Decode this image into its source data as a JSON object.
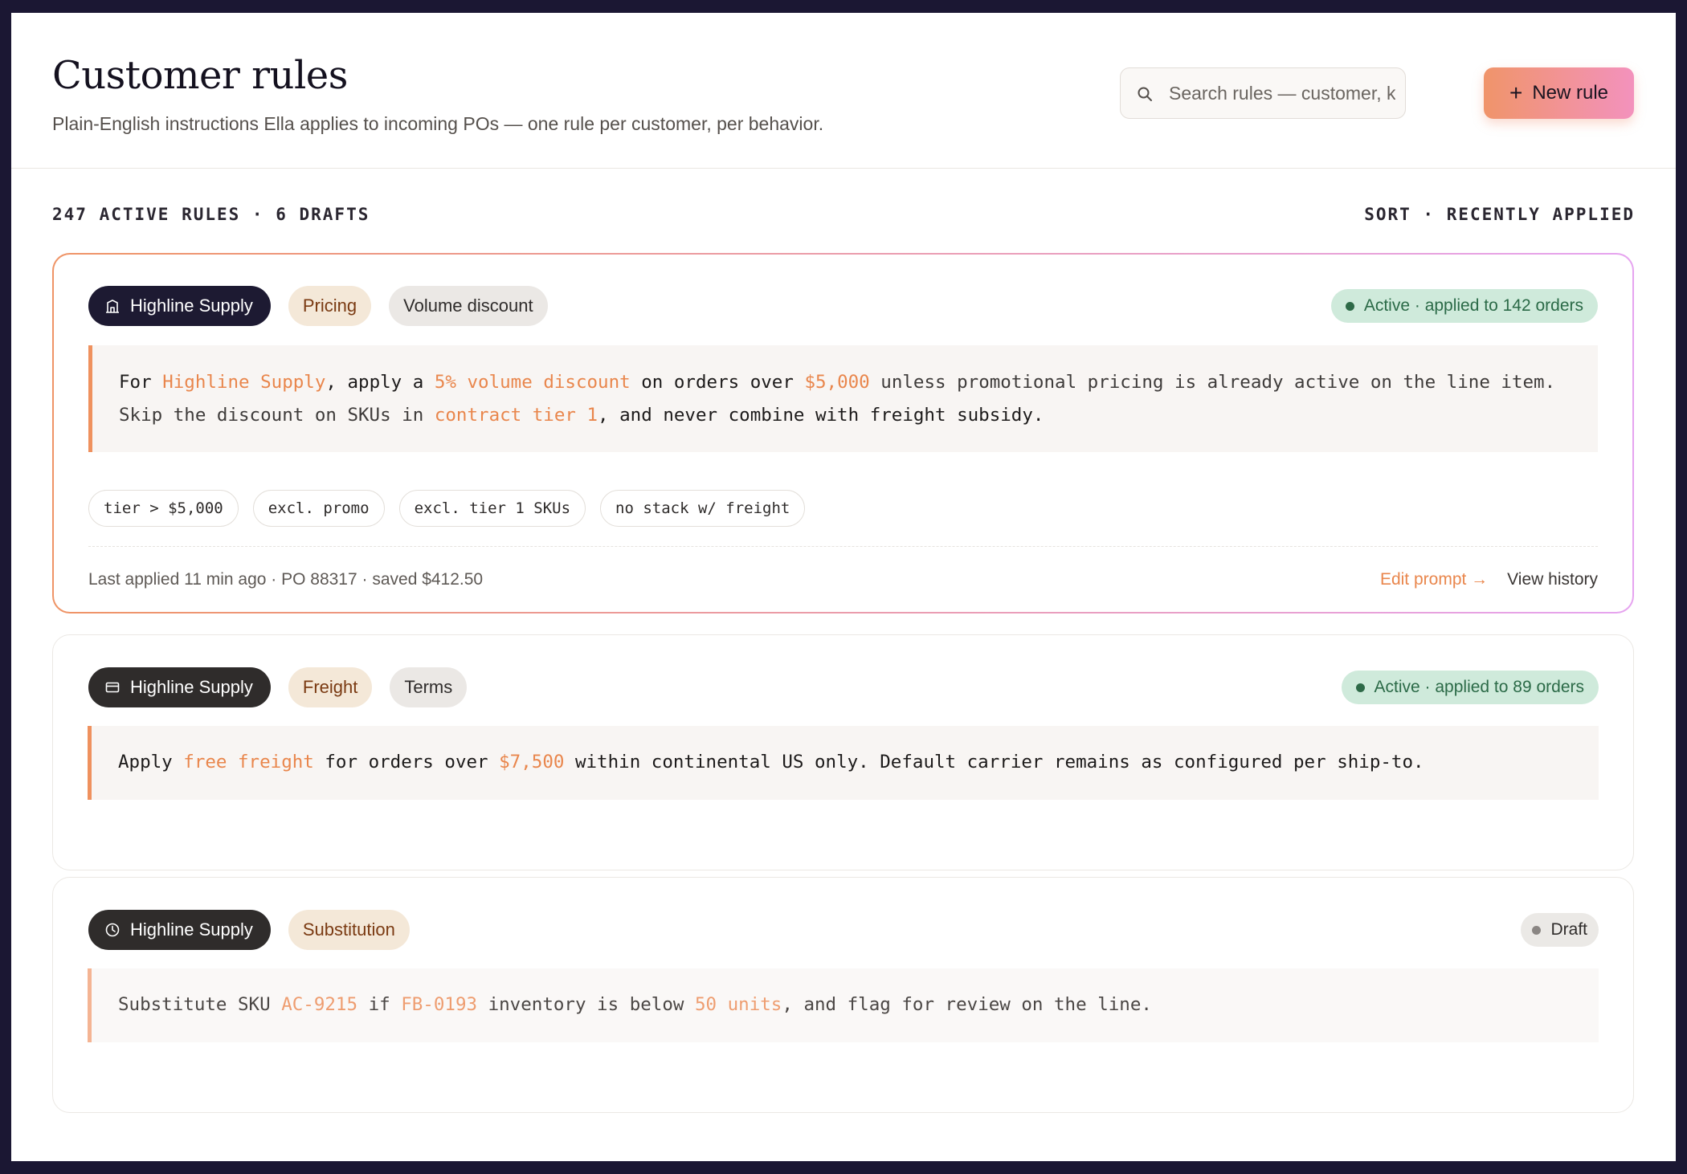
{
  "header": {
    "title": "Customer rules",
    "subtitle": "Plain-English instructions Ella applies to incoming POs — one rule per customer, per behavior.",
    "search_placeholder": "Search rules — customer, keyword",
    "new_rule_label": "New rule",
    "new_rule_icon": "+"
  },
  "meta": {
    "counts": "247 ACTIVE RULES · 6 DRAFTS",
    "sort": "SORT · RECENTLY APPLIED"
  },
  "colors": {
    "accent": "#e9864c",
    "active_bg": "#cfeadb",
    "active_text": "#2b6a47",
    "dark_chip": "#1d1a32"
  },
  "rules": [
    {
      "customer": "Highline Supply",
      "customer_icon": "building-icon",
      "category": "Pricing",
      "type": "Volume discount",
      "status": "Active · applied to 142 orders",
      "prompt": {
        "p1": "For ",
        "h1": "Highline Supply",
        "p2": ", apply a ",
        "h2": "5% volume discount",
        "p3": " on orders over ",
        "h3": "$5,000",
        "p4": " unless promotional pricing is already active on the line item. Skip the discount on SKUs in ",
        "h4": "contract tier 1",
        "p5": ", and never combine with freight subsidy."
      },
      "tags": [
        "tier > $5,000",
        "excl. promo",
        "excl. tier 1 SKUs",
        "no stack w/ freight"
      ],
      "footer": "Last applied 11 min ago · PO 88317 · saved $412.50",
      "edit_label": "Edit prompt →",
      "history_label": "View history"
    },
    {
      "customer": "Highline Supply",
      "customer_icon": "card-icon",
      "category": "Freight",
      "type": "Terms",
      "status": "Active · applied to 89 orders",
      "prompt": {
        "p1": "Apply ",
        "h1": "free freight",
        "p2": " for orders over ",
        "h2": "$7,500",
        "p3": " within continental US only. Default carrier remains as configured per ship-to."
      }
    },
    {
      "customer": "Highline Supply",
      "customer_icon": "clock-icon",
      "category": "Substitution",
      "status": "Draft",
      "prompt": {
        "p1": "Substitute SKU ",
        "h1": "AC-9215",
        "p2": " if ",
        "h2": "FB-0193",
        "p3": " inventory is below ",
        "h3": "50 units",
        "p4": ", and flag for review on the line."
      }
    }
  ]
}
